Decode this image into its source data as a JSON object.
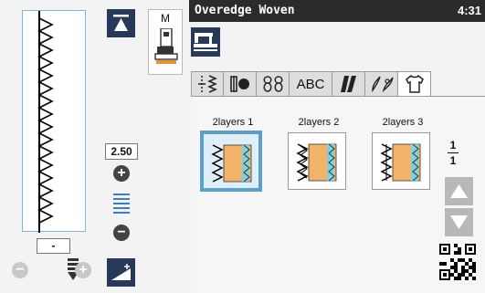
{
  "header": {
    "title": "Overedge Woven",
    "time": "4:31"
  },
  "left_panel": {
    "width_value": "-",
    "length_value": "2.50",
    "foot_label": "M",
    "plus_symbol": "+",
    "minus_symbol": "−"
  },
  "tabs": [
    {
      "label": "⫰≷",
      "icon": "utility-stitch-icon"
    },
    {
      "label": "⊪●",
      "icon": "buttonhole-icon"
    },
    {
      "label": "ꝏ",
      "icon": "decorative-stitch-icon"
    },
    {
      "label": "ABC",
      "icon": "character-icon"
    },
    {
      "label": "▞",
      "icon": "satin-stitch-icon"
    },
    {
      "label": "✿",
      "icon": "floral-stitch-icon"
    },
    {
      "label": "👕",
      "icon": "garment-icon"
    }
  ],
  "patterns": [
    {
      "label": "2layers 1",
      "selected": true
    },
    {
      "label": "2layers 2",
      "selected": false
    },
    {
      "label": "2layers 3",
      "selected": false
    }
  ],
  "pager": {
    "current": "1",
    "total": "1"
  },
  "colors": {
    "accent": "#5aa0c8",
    "button_dark": "#26395a",
    "titlebar": "#2b2b2b"
  }
}
